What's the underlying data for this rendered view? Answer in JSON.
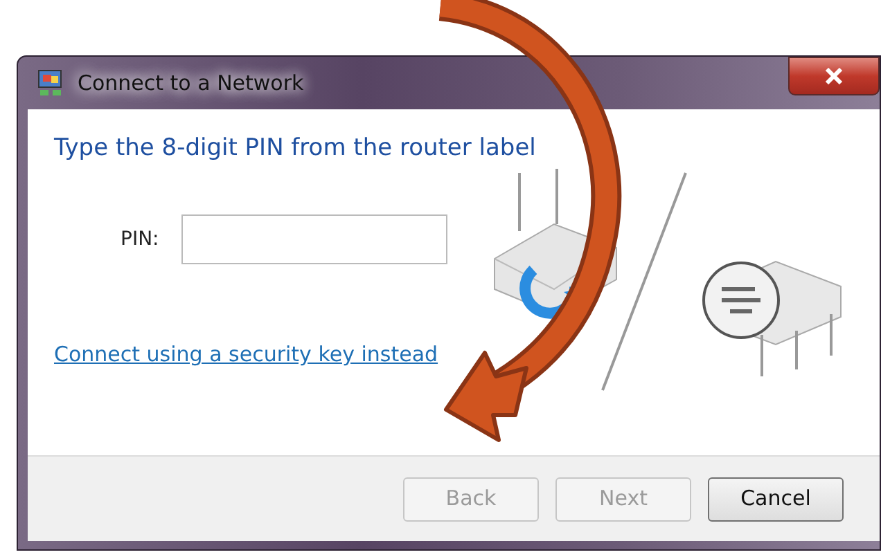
{
  "window": {
    "title": "Connect to a Network"
  },
  "heading": "Type the 8-digit PIN from the router label",
  "pin_field": {
    "label": "PIN:"
  },
  "link": "Connect using a security key instead",
  "buttons": [
    {
      "label": "Back",
      "disabled": true
    },
    {
      "label": "Next",
      "disabled": true
    },
    {
      "label": "Cancel",
      "disabled": false
    }
  ]
}
